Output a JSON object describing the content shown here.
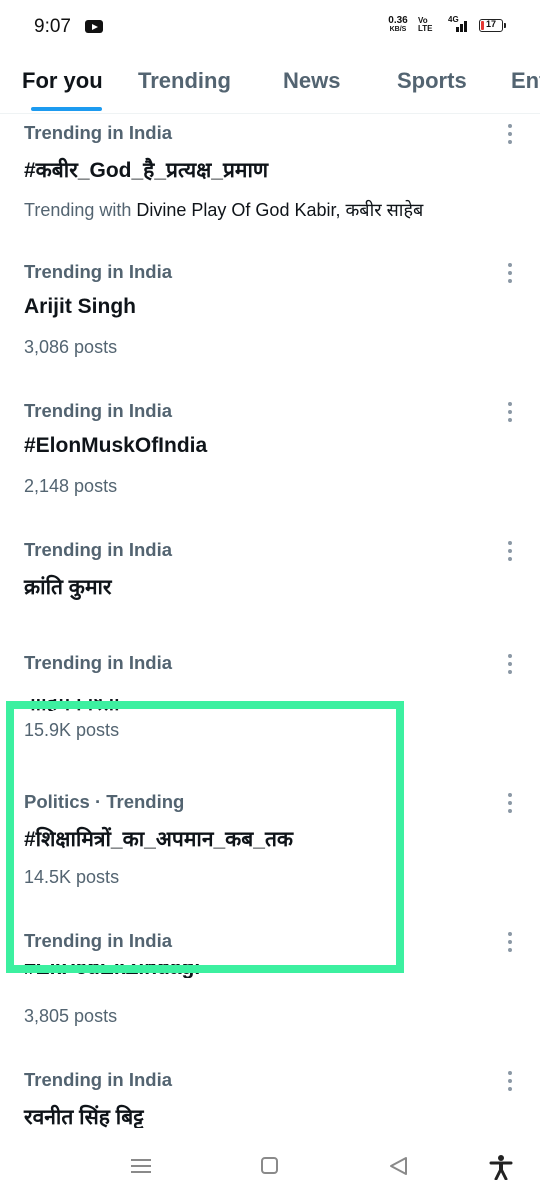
{
  "status_bar": {
    "time": "9:07",
    "app_icon": "youtube-icon",
    "net_speed_value": "0.36",
    "net_speed_unit": "KB/S",
    "volte_line1": "Vo",
    "volte_line2": "LTE",
    "network_type": "4G",
    "battery_level": "17",
    "battery_fraction": 0.17,
    "battery_low_color": "#e53935"
  },
  "tabs": [
    {
      "label": "For you",
      "active": true
    },
    {
      "label": "Trending"
    },
    {
      "label": "News"
    },
    {
      "label": "Sports"
    },
    {
      "label": "Entertainment"
    }
  ],
  "accent_color": "#1d9bf0",
  "trends": [
    {
      "context": "Trending in India",
      "name": "#कबीर_God_है_प्रत्यक्ष_प्रमाण",
      "meta_prefix": "Trending with ",
      "meta_highlight": "Divine Play Of God Kabir, कबीर साहेब"
    },
    {
      "context": "Trending in India",
      "name": "Arijit Singh",
      "meta": "3,086 posts"
    },
    {
      "context": "Trending in India",
      "name": "#ElonMuskOfIndia",
      "meta": "2,148 posts"
    },
    {
      "context": "Trending in India",
      "name": "क्रांति कुमार"
    },
    {
      "context": "Trending in India",
      "name": "नाहिम निश्ती",
      "meta": "15.9K posts"
    },
    {
      "context": "Politics · Trending",
      "name": "#शिक्षामित्रों_का_अपमान_कब_तक",
      "meta": "14.5K posts"
    },
    {
      "context": "Trending in India",
      "name": "#EkPedEkZindagi",
      "meta": "3,805 posts"
    },
    {
      "context": "Trending in India",
      "name": "रवनीत सिंह बिट्टू"
    }
  ],
  "icons": {
    "more": "more-vertical-icon",
    "nav_menu": "menu-icon",
    "nav_home": "home-square-icon",
    "nav_back": "back-triangle-icon",
    "nav_accessibility": "accessibility-icon"
  },
  "highlight_color": "#3cf0a0"
}
